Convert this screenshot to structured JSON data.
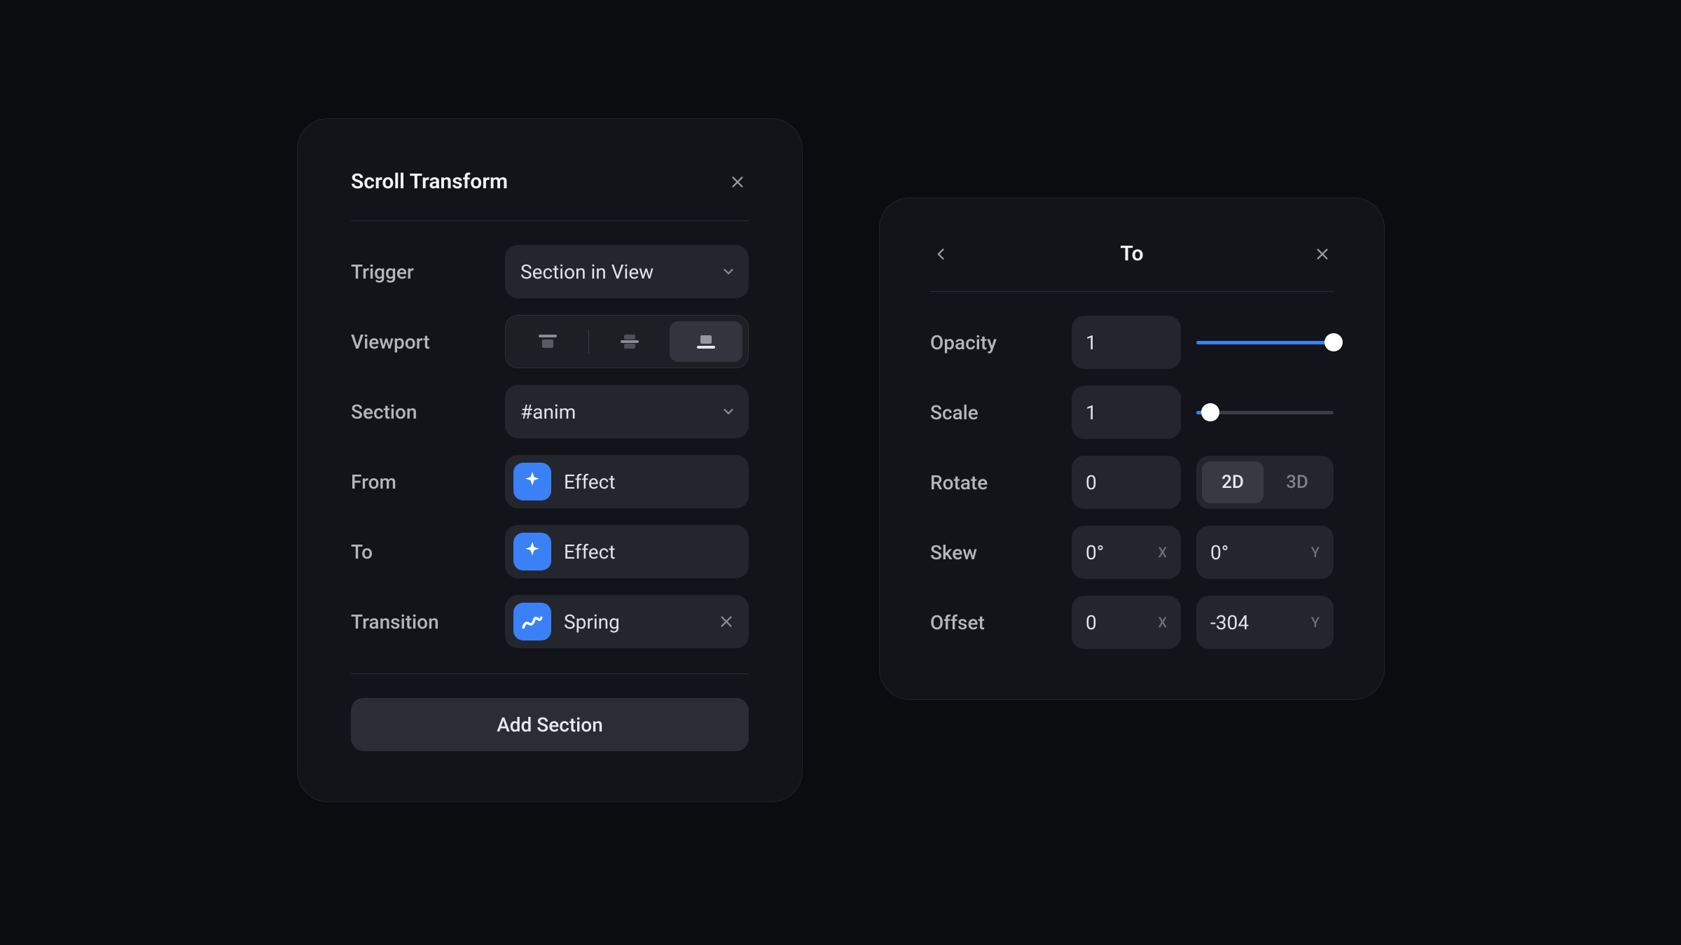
{
  "panel1": {
    "title": "Scroll Transform",
    "rows": {
      "trigger": {
        "label": "Trigger",
        "value": "Section in View"
      },
      "viewport": {
        "label": "Viewport",
        "active": 2
      },
      "section": {
        "label": "Section",
        "value": "#anim"
      },
      "from": {
        "label": "From",
        "value": "Effect"
      },
      "to": {
        "label": "To",
        "value": "Effect"
      },
      "transition": {
        "label": "Transition",
        "value": "Spring"
      }
    },
    "add_button": "Add Section"
  },
  "panel2": {
    "title": "To",
    "rows": {
      "opacity": {
        "label": "Opacity",
        "value": "1",
        "slider_percent": 100
      },
      "scale": {
        "label": "Scale",
        "value": "1",
        "slider_percent": 10
      },
      "rotate": {
        "label": "Rotate",
        "value": "0",
        "dim_active": "2D",
        "dim_options": [
          "2D",
          "3D"
        ]
      },
      "skew": {
        "label": "Skew",
        "x": "0°",
        "y": "0°",
        "x_axis": "X",
        "y_axis": "Y"
      },
      "offset": {
        "label": "Offset",
        "x": "0",
        "y": "-304",
        "x_axis": "X",
        "y_axis": "Y"
      }
    }
  }
}
